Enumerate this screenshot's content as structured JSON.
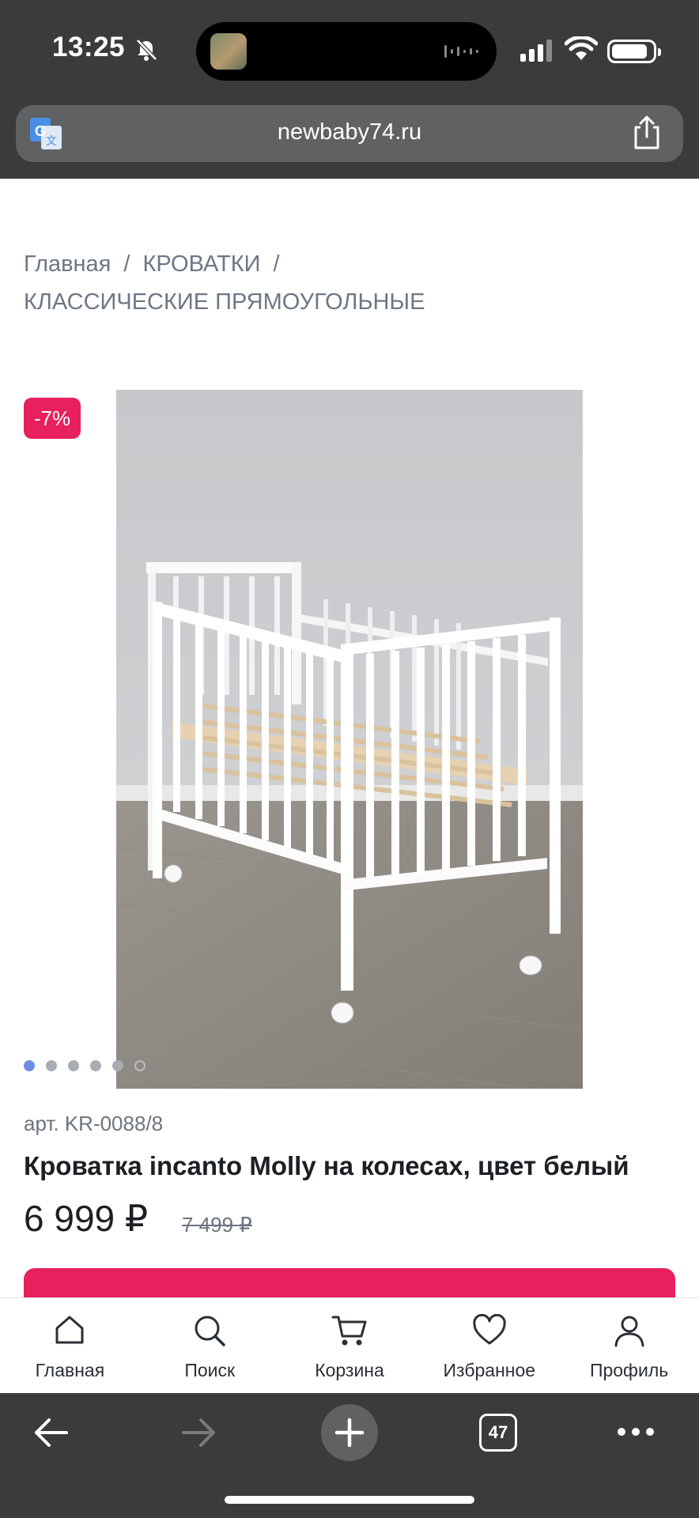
{
  "status_bar": {
    "time": "13:25"
  },
  "browser": {
    "url": "newbaby74.ru",
    "tabs_count": "47"
  },
  "breadcrumb": {
    "items": [
      "Главная",
      "КРОВАТКИ",
      "КЛАССИЧЕСКИЕ ПРЯМОУГОЛЬНЫЕ"
    ],
    "separator": "/"
  },
  "product": {
    "discount": "-7%",
    "sku": "арт. KR-0088/8",
    "title": "Кроватка incanto Molly на колесах, цвет белый",
    "price": "6 999 ₽",
    "old_price": "7 499 ₽",
    "image_count": 6,
    "active_image": 1
  },
  "site_nav": {
    "items": [
      {
        "label": "Главная",
        "icon": "home-icon"
      },
      {
        "label": "Поиск",
        "icon": "search-icon"
      },
      {
        "label": "Корзина",
        "icon": "cart-icon"
      },
      {
        "label": "Избранное",
        "icon": "heart-icon"
      },
      {
        "label": "Профиль",
        "icon": "profile-icon"
      }
    ]
  },
  "colors": {
    "accent": "#e8205d",
    "chrome": "#3a3b3d",
    "active_dot": "#6e8ee6"
  }
}
